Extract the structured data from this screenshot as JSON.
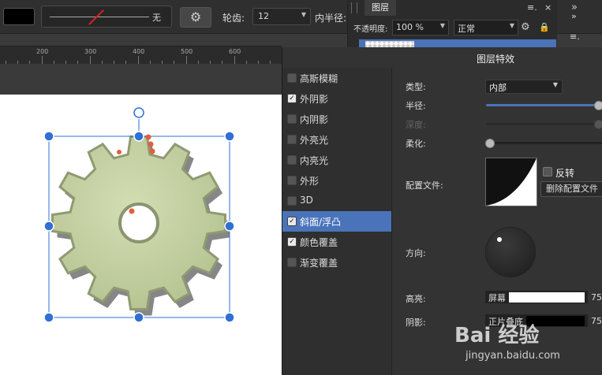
{
  "toolbar": {
    "stroke_none_label": "无",
    "gear_glyph": "⚙",
    "teeth_label": "轮齿:",
    "teeth_value": "12",
    "inner_radius_label": "内半径:",
    "right_arrow": "»"
  },
  "ruler": {
    "ticks": [
      "200",
      "300",
      "400",
      "500",
      "600"
    ]
  },
  "layers_panel": {
    "tab_label": "图层",
    "menu_glyph": "≡.",
    "close_glyph": "×",
    "opacity_label": "不透明度:",
    "opacity_value": "100 %",
    "blend_mode": "正常",
    "collapse_glyph": "»",
    "side_menu_glyph": "≡."
  },
  "fx_dialog": {
    "title": "图层特效",
    "effects": [
      {
        "label": "高斯模糊",
        "checked": false,
        "active": false
      },
      {
        "label": "外阴影",
        "checked": true,
        "active": false
      },
      {
        "label": "内阴影",
        "checked": false,
        "active": false
      },
      {
        "label": "外亮光",
        "checked": false,
        "active": false
      },
      {
        "label": "内亮光",
        "checked": false,
        "active": false
      },
      {
        "label": "外形",
        "checked": false,
        "active": false
      },
      {
        "label": "3D",
        "checked": false,
        "active": false
      },
      {
        "label": "斜面/浮凸",
        "checked": true,
        "active": true
      },
      {
        "label": "颜色覆盖",
        "checked": true,
        "active": false
      },
      {
        "label": "渐变覆盖",
        "checked": false,
        "active": false
      }
    ],
    "props": {
      "type_label": "类型:",
      "type_value": "内部",
      "radius_label": "半径:",
      "radius_level": 0.96,
      "depth_label": "深度:",
      "depth_level": 0.96,
      "soften_label": "柔化:",
      "soften_level": 0.0,
      "profile_label": "配置文件:",
      "invert_label": "反转",
      "delete_profile_label": "删除配置文件",
      "direction_label": "方向:",
      "highlight_label": "高亮:",
      "highlight_mode": "屏幕",
      "highlight_pct": "75",
      "highlight_color": "#ffffff",
      "shadow_label": "阴影:",
      "shadow_mode": "正片叠底",
      "shadow_pct": "75",
      "shadow_color": "#000000"
    }
  },
  "watermark": {
    "text": "Bai 经验",
    "sub": "jingyan.baidu.com"
  },
  "colors": {
    "accent": "#4a73b9",
    "gear_fill": "#c8d4a6",
    "handle_blue": "#2f6fd6",
    "handle_orange": "#e0603a"
  }
}
